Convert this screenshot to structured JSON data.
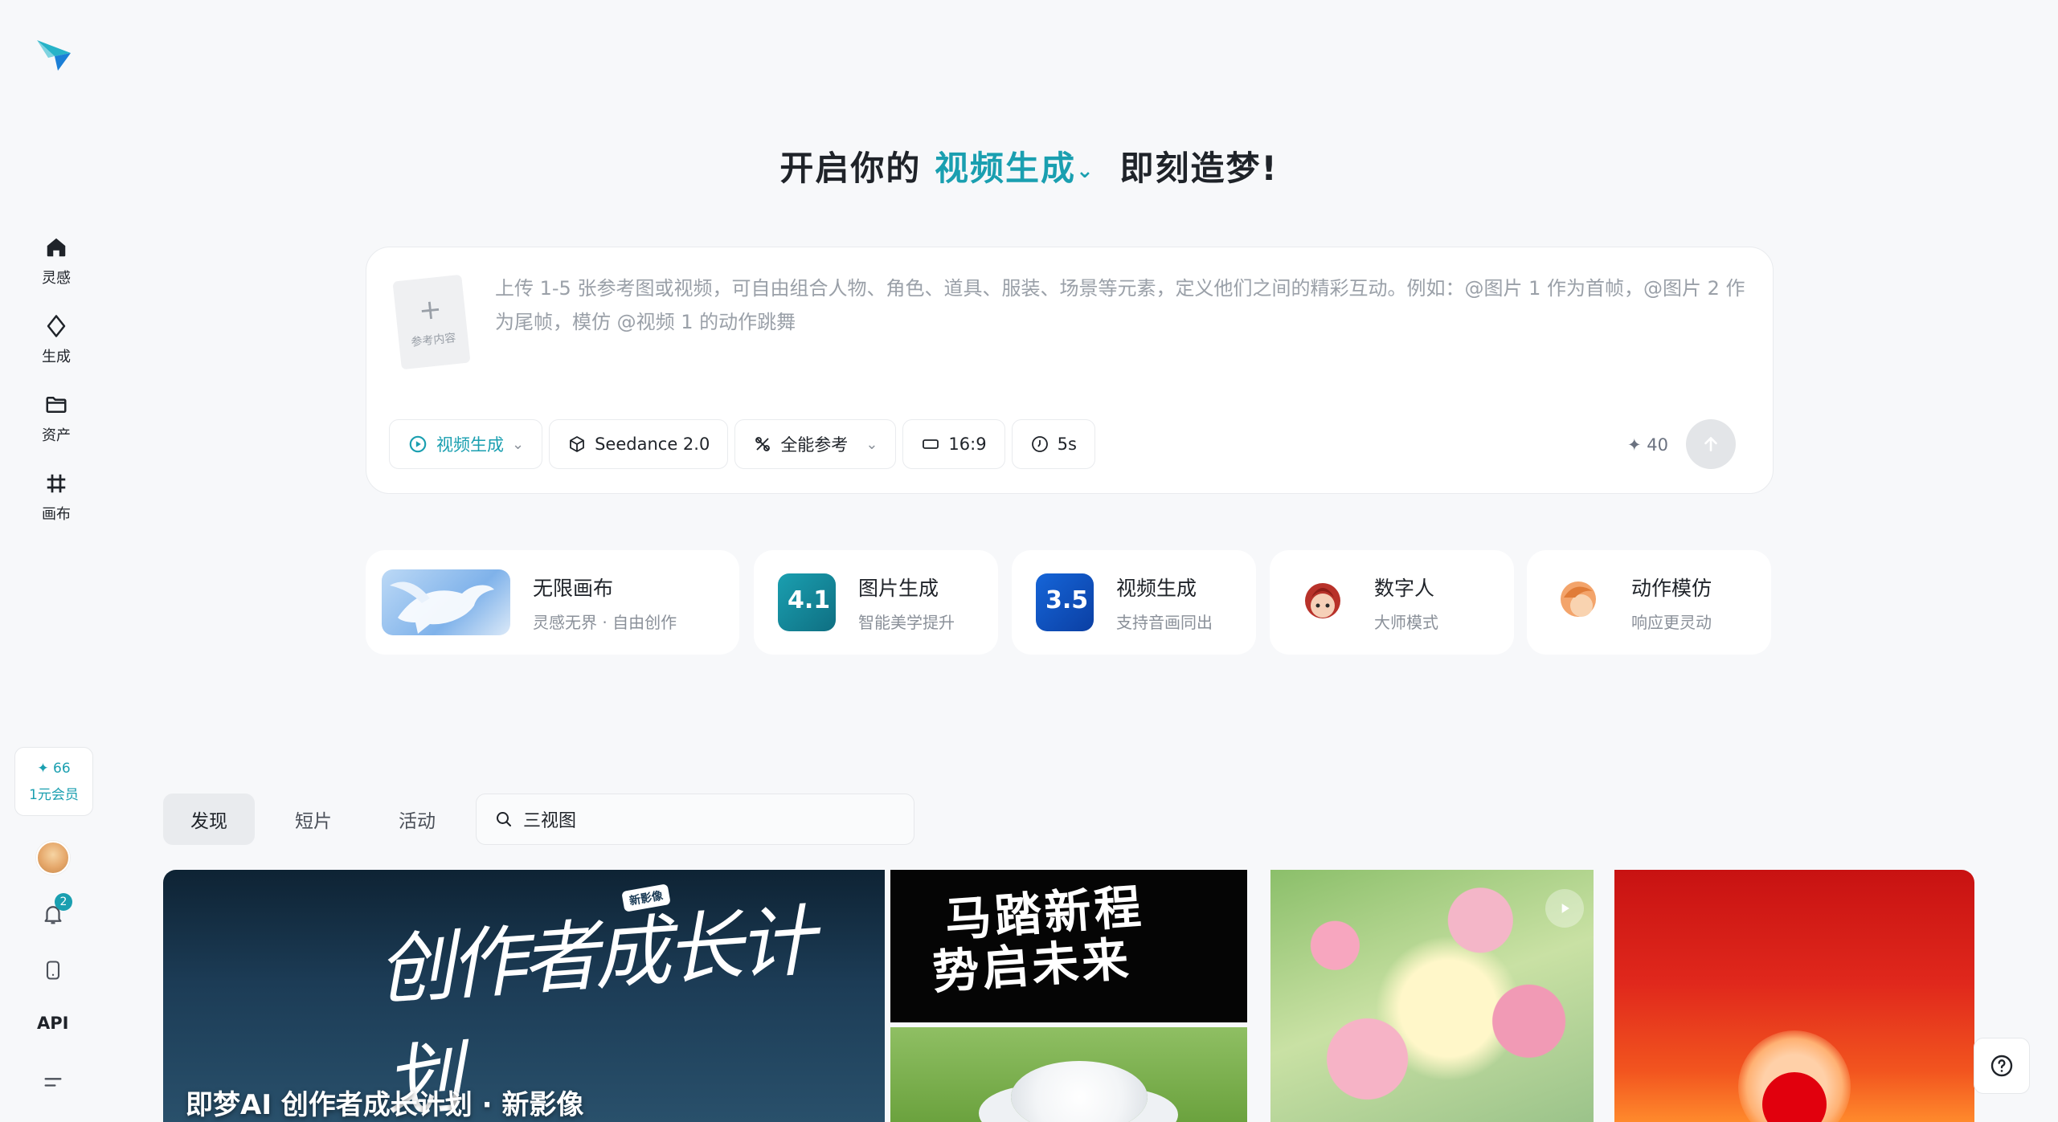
{
  "sidebar": {
    "logo_icon": "paper-plane-logo",
    "nav": [
      {
        "label": "灵感",
        "icon": "home-icon"
      },
      {
        "label": "生成",
        "icon": "sparkle-diamond-icon"
      },
      {
        "label": "资产",
        "icon": "folder-icon"
      },
      {
        "label": "画布",
        "icon": "canvas-grid-icon"
      }
    ],
    "credits": {
      "value": "✦ 66",
      "label": "1元会员"
    },
    "notifications_count": "2",
    "api_label": "API"
  },
  "hero": {
    "prefix": "开启你的",
    "mode": "视频生成",
    "suffix": "即刻造梦!"
  },
  "prompt": {
    "upload_label": "参考内容",
    "placeholder": "上传 1-5 张参考图或视频，可自由组合人物、角色、道具、服装、场景等元素，定义他们之间的精彩互动。例如：@图片 1 作为首帧，@图片 2 作为尾帧，模仿 @视频 1 的动作跳舞",
    "toolbar": {
      "mode": "视频生成",
      "model": "Seedance 2.0",
      "reference": "全能参考",
      "ratio": "16:9",
      "duration": "5s"
    },
    "cost": "✦ 40"
  },
  "features": [
    {
      "title": "无限画布",
      "subtitle": "灵感无界 · 自由创作"
    },
    {
      "title": "图片生成",
      "subtitle": "智能美学提升",
      "badge": "4.1"
    },
    {
      "title": "视频生成",
      "subtitle": "支持音画同出",
      "badge": "3.5"
    },
    {
      "title": "数字人",
      "subtitle": "大师模式"
    },
    {
      "title": "动作模仿",
      "subtitle": "响应更灵动"
    }
  ],
  "discover": {
    "tabs": [
      "发现",
      "短片",
      "活动"
    ],
    "active_tab": "发现",
    "search_value": "三视图"
  },
  "gallery": {
    "main_caption": "即梦AI 创作者成长计划 · 新影像",
    "main_title_art": "创作者成长计划",
    "main_stamp": "新影像",
    "horse_slogan_line1": "马踏新程",
    "horse_slogan_line2": "势启未来"
  },
  "colors": {
    "accent": "#1a9fb0",
    "background": "#f7f8fa",
    "card": "#ffffff"
  }
}
